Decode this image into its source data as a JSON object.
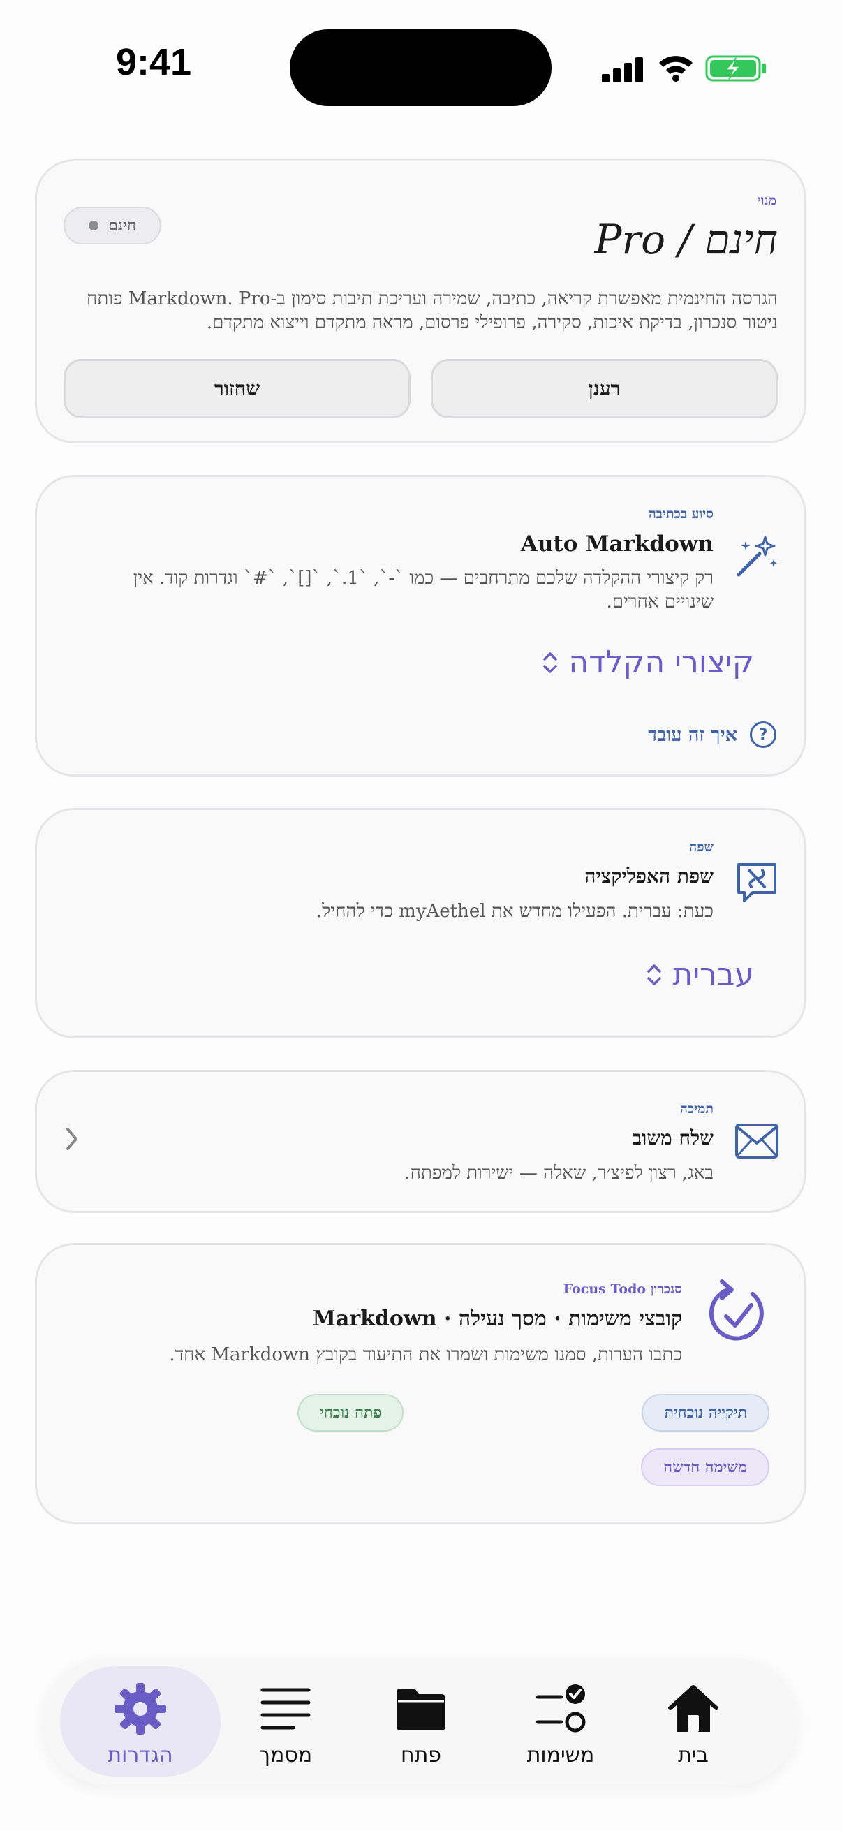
{
  "status_bar": {
    "time": "9:41"
  },
  "plan": {
    "kicker": "מנוי",
    "title": "חינם / Pro",
    "badge": "חינם",
    "description": "הגרסה החינמית מאפשרת קריאה, כתיבה, שמירה ועריכת תיבות סימון ב-Markdown. Pro פותח ניטור סנכרון, בדיקת איכות, סקירה, פרופילי פרסום, מראה מתקדם וייצוא מתקדם.",
    "refresh_label": "רענן",
    "restore_label": "שחזור"
  },
  "writing": {
    "kicker": "סיוע בכתיבה",
    "title": "Auto Markdown",
    "description": "רק קיצורי ההקלדה שלכם מתרחבים — כמו `-`, `1.`, `[]`, `#` וגדרות קוד. אין שינויים אחרים.",
    "picker_value": "קיצורי הקלדה",
    "help_label": "איך זה עובד",
    "help_glyph": "?"
  },
  "language": {
    "kicker": "שפה",
    "title": "שפת האפליקציה",
    "description": "כעת: עברית. הפעילו מחדש את myAethel כדי להחיל.",
    "picker_value": "עברית"
  },
  "support": {
    "kicker": "תמיכה",
    "title": "שלח משוב",
    "description": "באג, רצון לפיצ׳ר, שאלה — ישירות למפתח."
  },
  "focus": {
    "kicker": "סנכרון Focus Todo",
    "title": "קובצי משימות · מסך נעילה · Markdown",
    "description": "כתבו הערות, סמנו משימות ושמרו את התיעוד בקובץ Markdown אחד.",
    "chip_folder": "תיקייה נוכחית",
    "chip_open": "פתח נוכחי",
    "chip_new": "משימה חדשה"
  },
  "tabs": {
    "home": "בית",
    "tasks": "משימות",
    "open": "פתח",
    "document": "מסמך",
    "settings": "הגדרות"
  },
  "colors": {
    "accent": "#6a5cc4",
    "link_blue": "#3f63a6",
    "battery_green": "#34c759"
  }
}
